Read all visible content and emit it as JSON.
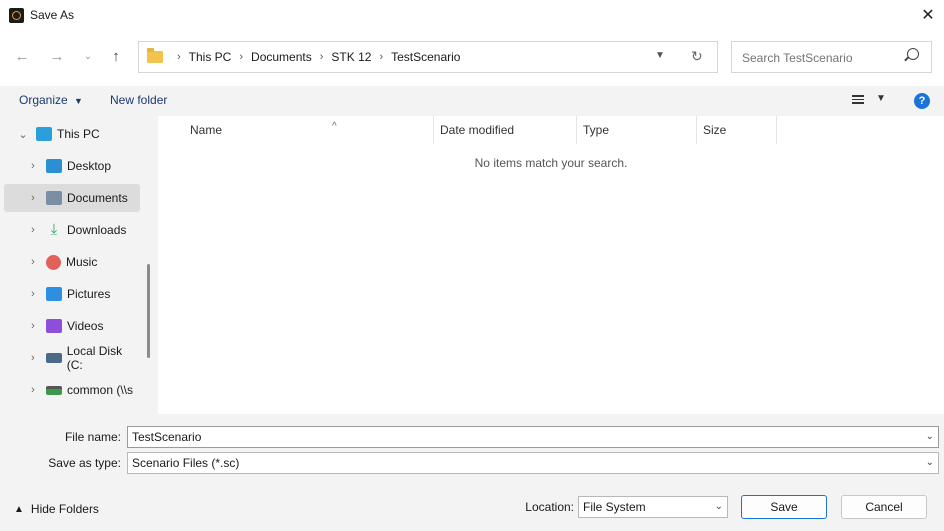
{
  "window": {
    "title": "Save As"
  },
  "nav": {
    "breadcrumbs": [
      "This PC",
      "Documents",
      "STK 12",
      "TestScenario"
    ],
    "search_placeholder": "Search TestScenario"
  },
  "toolbar": {
    "organize": "Organize",
    "new_folder": "New folder",
    "help": "?"
  },
  "sidebar": {
    "items": [
      {
        "label": "This PC",
        "icon": "monitor-icon",
        "color": "#2b9fd9"
      },
      {
        "label": "Desktop",
        "icon": "desktop-icon",
        "color": "#2b8fd3"
      },
      {
        "label": "Documents",
        "icon": "documents-icon",
        "color": "#7a8fa6"
      },
      {
        "label": "Downloads",
        "icon": "downloads-icon",
        "color": "#2ba86a"
      },
      {
        "label": "Music",
        "icon": "music-icon",
        "color": "#e0625a"
      },
      {
        "label": "Pictures",
        "icon": "pictures-icon",
        "color": "#2d8fe0"
      },
      {
        "label": "Videos",
        "icon": "videos-icon",
        "color": "#8b4fd9"
      },
      {
        "label": "Local Disk (C:",
        "icon": "disk-icon",
        "color": "#4a6a8a"
      },
      {
        "label": "common (\\\\s",
        "icon": "network-drive-icon",
        "color": "#3a9a4a"
      }
    ]
  },
  "columns": [
    "Name",
    "Date modified",
    "Type",
    "Size"
  ],
  "empty_message": "No items match your search.",
  "form": {
    "file_name_label": "File name:",
    "file_name_value": "TestScenario",
    "save_type_label": "Save as type:",
    "save_type_value": "Scenario Files (*.sc)",
    "location_label": "Location:",
    "location_value": "File System"
  },
  "buttons": {
    "save": "Save",
    "cancel": "Cancel",
    "hide_folders": "Hide Folders"
  }
}
